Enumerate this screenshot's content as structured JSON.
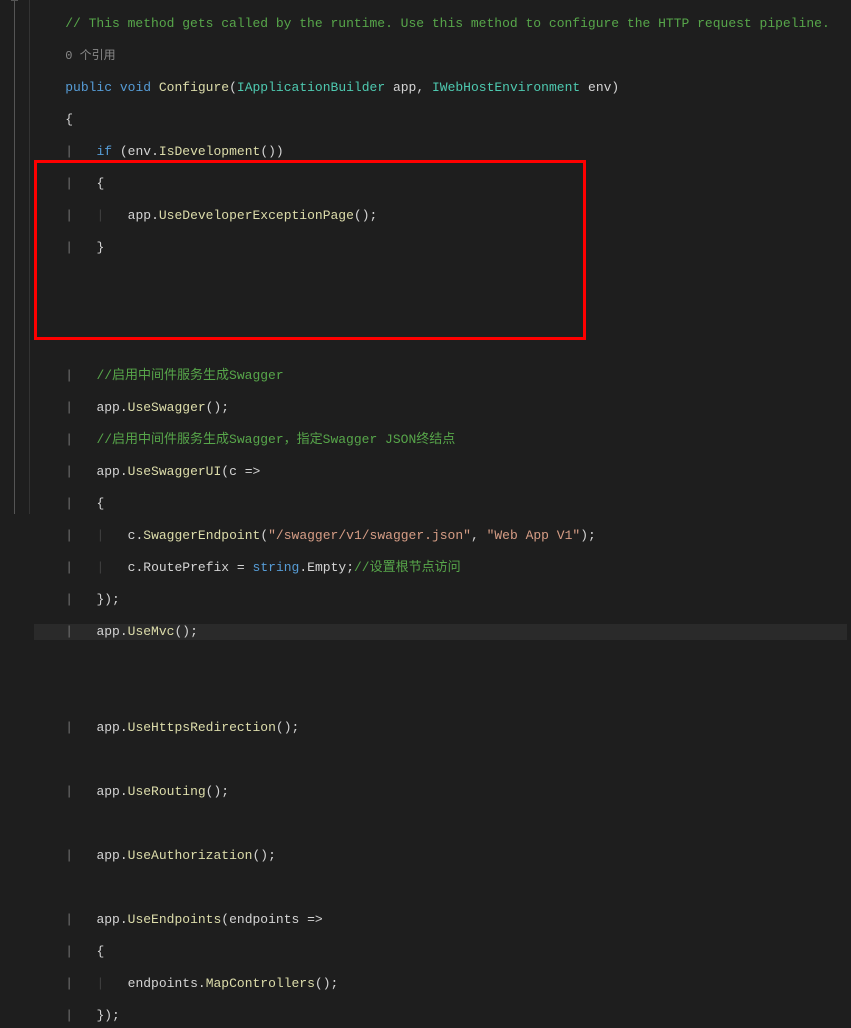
{
  "code": {
    "comment_header": "// This method gets called by the runtime. Use this method to configure the HTTP request pipeline.",
    "codelens": "0 个引用",
    "kw_public": "public",
    "kw_void": "void",
    "method_configure": "Configure",
    "type_iappbuilder": "IApplicationBuilder",
    "param_app": "app",
    "type_iwebhostenv": "IWebHostEnvironment",
    "param_env": "env",
    "kw_if": "if",
    "env_ident": "env",
    "isdev": "IsDevelopment",
    "app1": "app",
    "usedevexc": "UseDeveloperExceptionPage",
    "comment_swagger1": "//启用中间件服务生成Swagger",
    "app2": "app",
    "useswagger": "UseSwagger",
    "comment_swagger2": "//启用中间件服务生成Swagger，指定Swagger JSON终结点",
    "app3": "app",
    "useswaggerui": "UseSwaggerUI",
    "lambda_c": "c",
    "c1": "c",
    "swaggerendpoint": "SwaggerEndpoint",
    "str_swagger_path": "\"/swagger/v1/swagger.json\"",
    "str_webapp": "\"Web App V1\"",
    "c2": "c",
    "routeprefix": "RoutePrefix",
    "kw_string": "string",
    "empty": "Empty",
    "comment_route": "//设置根节点访问",
    "app4": "app",
    "usemvc": "UseMvc",
    "app5": "app",
    "usehttpsredir": "UseHttpsRedirection",
    "app6": "app",
    "userouting": "UseRouting",
    "app7": "app",
    "useauth": "UseAuthorization",
    "app8": "app",
    "useendpoints": "UseEndpoints",
    "lambda_endpoints": "endpoints",
    "endpoints_ident": "endpoints",
    "mapcontrollers": "MapControllers"
  }
}
